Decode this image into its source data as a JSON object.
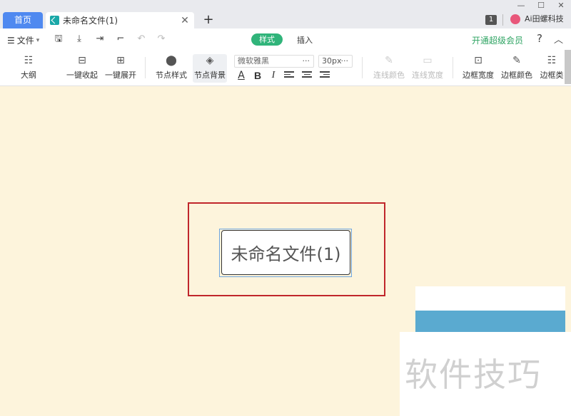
{
  "tabs": {
    "home_label": "首页",
    "doc_title": "未命名文件(1)",
    "close_label": "✕",
    "add_label": "+"
  },
  "window": {
    "minimize": "—",
    "maximize": "☐",
    "close": "✕"
  },
  "account": {
    "badge_count": "1",
    "user_name": "Ai田螺科技",
    "avatar_color": "#e8577a"
  },
  "menu": {
    "file_label": "文件",
    "style_tab": "样式",
    "insert_tab": "插入",
    "vip_link": "开通超级会员",
    "help": "?",
    "collapse": "︿"
  },
  "toolbar": {
    "outline": "大纲",
    "collapse_all": "一键收起",
    "expand_all": "一键展开",
    "node_style": "节点样式",
    "node_bg": "节点背景",
    "font_name": "微软雅黑",
    "font_size": "30px",
    "dots": "···",
    "bold": "B",
    "italic": "I",
    "underline_a": "A",
    "line_color": "连线颜色",
    "line_width": "连线宽度",
    "border_width": "边框宽度",
    "border_color": "边框颜色",
    "border_type": "边框类"
  },
  "canvas": {
    "node_text": "未命名文件(1)",
    "watermark": "软件技巧",
    "background": "#fdf4dc",
    "highlight_color": "#c0262b"
  },
  "colors": {
    "accent_blue": "#4f89f0",
    "accent_green": "#30b47a"
  }
}
